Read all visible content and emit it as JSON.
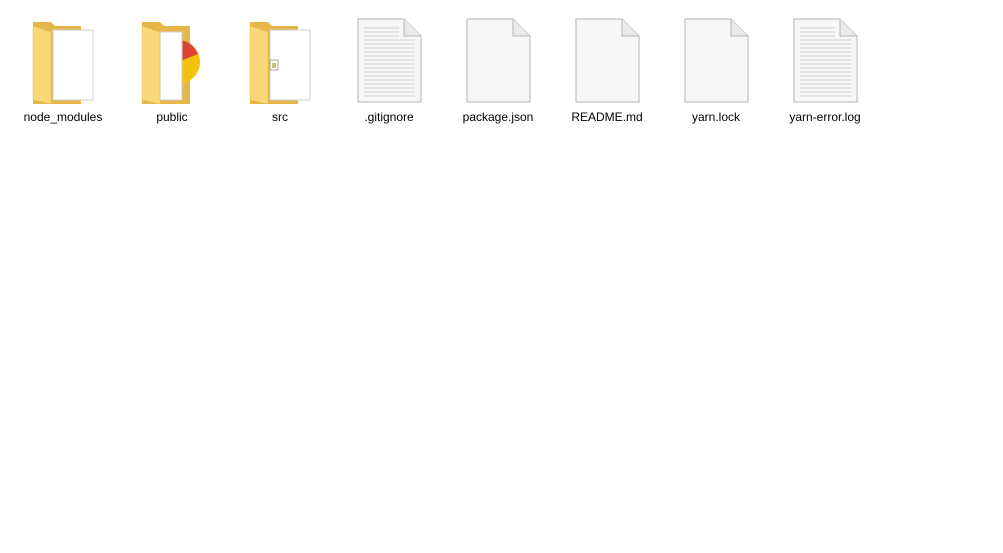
{
  "items": [
    {
      "name": "node_modules",
      "type": "folder",
      "icon": "folder-icon"
    },
    {
      "name": "public",
      "type": "folder",
      "icon": "folder-chrome-icon"
    },
    {
      "name": "src",
      "type": "folder",
      "icon": "folder-javascript-icon"
    },
    {
      "name": ".gitignore",
      "type": "file",
      "icon": "text-file-icon"
    },
    {
      "name": "package.json",
      "type": "file",
      "icon": "blank-file-icon"
    },
    {
      "name": "README.md",
      "type": "file",
      "icon": "blank-file-icon"
    },
    {
      "name": "yarn.lock",
      "type": "file",
      "icon": "blank-file-icon"
    },
    {
      "name": "yarn-error.log",
      "type": "file",
      "icon": "text-file-icon"
    }
  ],
  "colors": {
    "folder_back": "#e6b64a",
    "folder_front": "#fbd877",
    "page_fill": "#f7f7f7",
    "page_border": "#b5b5b5",
    "chrome_red": "#db4437",
    "chrome_yellow": "#f4c20d"
  }
}
